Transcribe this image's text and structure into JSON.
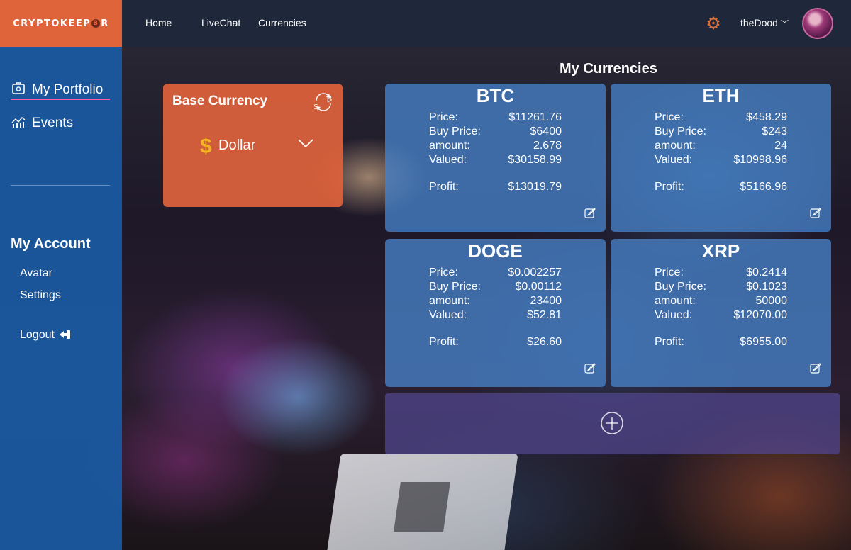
{
  "app": {
    "logo": "CRYPTOKEEP",
    "logo_b": "B",
    "logo_tail": "R"
  },
  "nav": {
    "home": "Home",
    "livechat": "LiveChat",
    "currencies": "Currencies"
  },
  "user": {
    "name": "theDood"
  },
  "sidebar": {
    "portfolio": "My Portfolio",
    "events": "Events",
    "account_title": "My Account",
    "avatar": "Avatar",
    "settings": "Settings",
    "logout": "Logout"
  },
  "base_currency": {
    "title": "Base Currency",
    "symbol": "$",
    "selected": "Dollar"
  },
  "currencies_title": "My Currencies",
  "labels": {
    "price": "Price:",
    "buy_price": "Buy Price:",
    "amount": "amount:",
    "valued": "Valued:",
    "profit": "Profit:"
  },
  "coins": [
    {
      "name": "BTC",
      "price": "$11261.76",
      "buy_price": "$6400",
      "amount": "2.678",
      "valued": "$30158.99",
      "profit": "$13019.79"
    },
    {
      "name": "ETH",
      "price": "$458.29",
      "buy_price": "$243",
      "amount": "24",
      "valued": "$10998.96",
      "profit": "$5166.96"
    },
    {
      "name": "DOGE",
      "price": "$0.002257",
      "buy_price": "$0.00112",
      "amount": "23400",
      "valued": "$52.81",
      "profit": "$26.60"
    },
    {
      "name": "XRP",
      "price": "$0.2414",
      "buy_price": "$0.1023",
      "amount": "50000",
      "valued": "$12070.00",
      "profit": "$6955.00"
    }
  ],
  "colors": {
    "brand_orange": "#e0643a",
    "sidebar_blue": "#1a58a0",
    "card_blue": "#4682c8",
    "accent_pink": "#ff5fa8",
    "gear_orange": "#d9703a",
    "dollar_gold": "#f5b523"
  }
}
